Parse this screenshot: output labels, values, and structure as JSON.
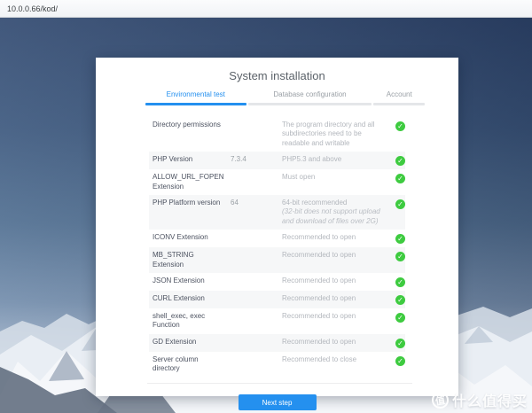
{
  "browser": {
    "url": "10.0.0.66/kod/"
  },
  "installer": {
    "title": "System installation",
    "tabs": [
      {
        "label": "Environmental test",
        "active": true
      },
      {
        "label": "Database configuration",
        "active": false
      },
      {
        "label": "Account",
        "active": false
      }
    ],
    "checks": [
      {
        "label": "Directory permissions",
        "value": "",
        "desc": "The program directory and all subdirectories need to be readable and writable",
        "note": "",
        "status": "pass"
      },
      {
        "label": "PHP Version",
        "value": "7.3.4",
        "desc": "PHP5.3 and above",
        "note": "",
        "status": "pass"
      },
      {
        "label": "ALLOW_URL_FOPEN Extension",
        "value": "",
        "desc": "Must open",
        "note": "",
        "status": "pass"
      },
      {
        "label": "PHP Platform version",
        "value": "64",
        "desc": "64-bit recommended",
        "note": "(32-bit does not support upload and download of files over 2G)",
        "status": "pass"
      },
      {
        "label": "ICONV Extension",
        "value": "",
        "desc": "Recommended to open",
        "note": "",
        "status": "pass"
      },
      {
        "label": "MB_STRING Extension",
        "value": "",
        "desc": "Recommended to open",
        "note": "",
        "status": "pass"
      },
      {
        "label": "JSON Extension",
        "value": "",
        "desc": "Recommended to open",
        "note": "",
        "status": "pass"
      },
      {
        "label": "CURL Extension",
        "value": "",
        "desc": "Recommended to open",
        "note": "",
        "status": "pass"
      },
      {
        "label": "shell_exec, exec Function",
        "value": "",
        "desc": "Recommended to open",
        "note": "",
        "status": "pass"
      },
      {
        "label": "GD Extension",
        "value": "",
        "desc": "Recommended to open",
        "note": "",
        "status": "pass"
      },
      {
        "label": "Server column directory",
        "value": "",
        "desc": "Recommended to close",
        "note": "",
        "status": "pass"
      }
    ],
    "next_button": "Next step",
    "status_icon": "check-circle-icon",
    "colors": {
      "accent_blue": "#2490ef",
      "check_green": "#3ecb40"
    }
  },
  "watermark": {
    "logo_char": "值",
    "text": "什么值得买"
  }
}
